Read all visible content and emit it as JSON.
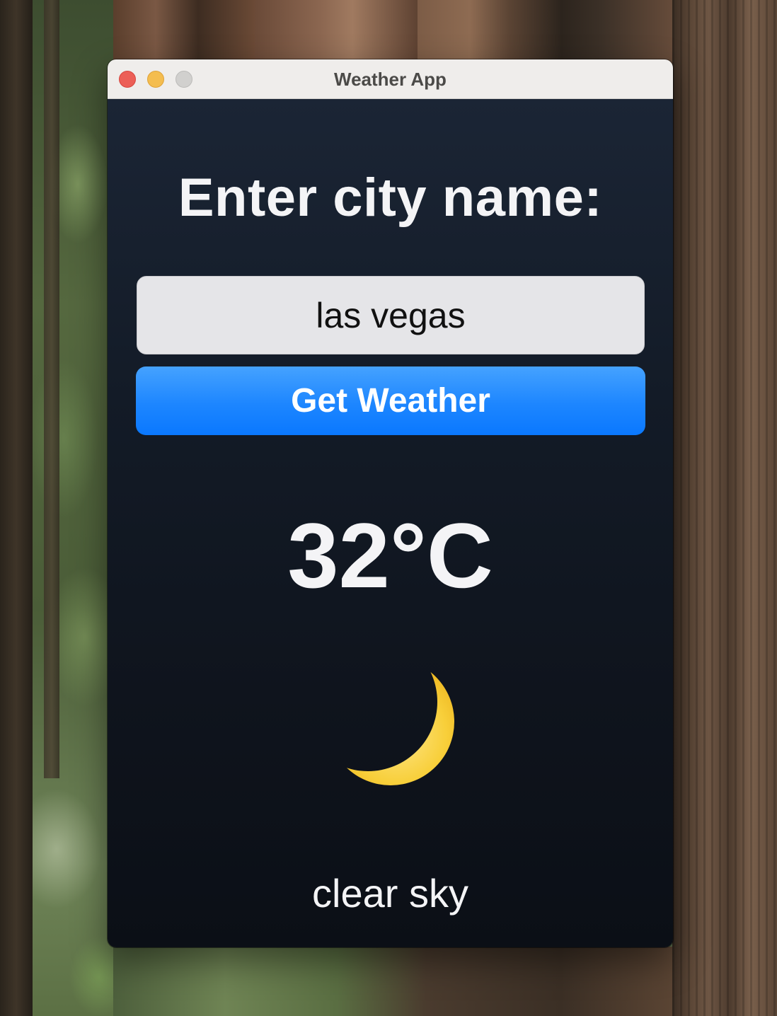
{
  "window": {
    "title": "Weather App"
  },
  "form": {
    "prompt": "Enter city name:",
    "city_value": "las vegas",
    "button_label": "Get Weather"
  },
  "weather": {
    "temperature": "32°C",
    "icon": "crescent-moon-icon",
    "description": "clear sky"
  },
  "colors": {
    "button": "#1d86ff",
    "background": "#131b27",
    "moon": "#f7c92e"
  }
}
